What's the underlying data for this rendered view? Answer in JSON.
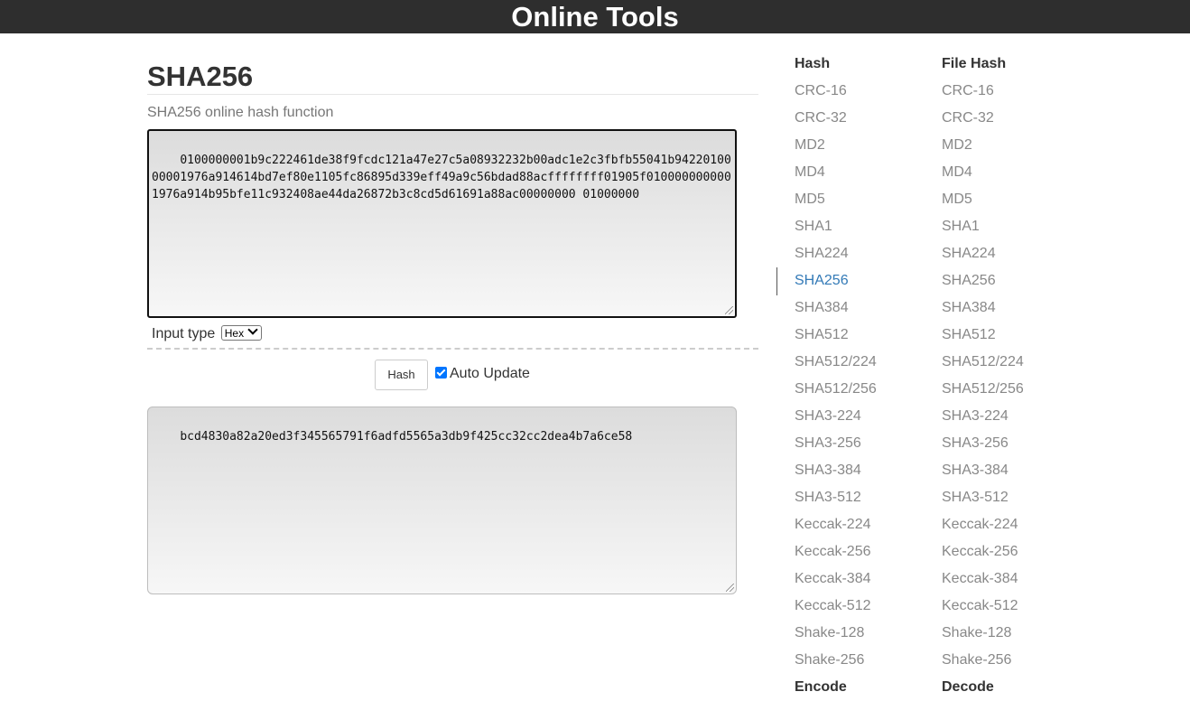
{
  "header": {
    "title": "Online Tools"
  },
  "main": {
    "title": "SHA256",
    "subtitle": "SHA256 online hash function",
    "input_text": "0100000001b9c222461de38f9fcdc121a47e27c5a08932232b00adc1e2c3fbfb55041b9422010000001976a914614bd7ef80e1105fc86895d339eff49a9c56bdad88acffffffff01905f0100000000001976a914b95bfe11c932408ae44da26872b3c8cd5d61691a88ac00000000 01000000",
    "input_type_label": "Input type",
    "input_type_selected": "Hex",
    "hash_button_label": "Hash",
    "auto_update_label": "Auto Update",
    "auto_update_checked": true,
    "output_text": "bcd4830a82a20ed3f345565791f6adfd5565a3db9f425cc32cc2dea4b7a6ce58"
  },
  "sidebar": {
    "hash_heading": "Hash",
    "file_hash_heading": "File Hash",
    "hash_items": [
      "CRC-16",
      "CRC-32",
      "MD2",
      "MD4",
      "MD5",
      "SHA1",
      "SHA224",
      "SHA256",
      "SHA384",
      "SHA512",
      "SHA512/224",
      "SHA512/256",
      "SHA3-224",
      "SHA3-256",
      "SHA3-384",
      "SHA3-512",
      "Keccak-224",
      "Keccak-256",
      "Keccak-384",
      "Keccak-512",
      "Shake-128",
      "Shake-256"
    ],
    "file_hash_items": [
      "CRC-16",
      "CRC-32",
      "MD2",
      "MD4",
      "MD5",
      "SHA1",
      "SHA224",
      "SHA256",
      "SHA384",
      "SHA512",
      "SHA512/224",
      "SHA512/256",
      "SHA3-224",
      "SHA3-256",
      "SHA3-384",
      "SHA3-512",
      "Keccak-224",
      "Keccak-256",
      "Keccak-384",
      "Keccak-512",
      "Shake-128",
      "Shake-256"
    ],
    "active_hash_item": "SHA256",
    "encode_heading": "Encode",
    "decode_heading": "Decode"
  },
  "colors": {
    "header_bg": "#2e2e2e",
    "active_link": "#337ab7",
    "link": "#888888"
  }
}
